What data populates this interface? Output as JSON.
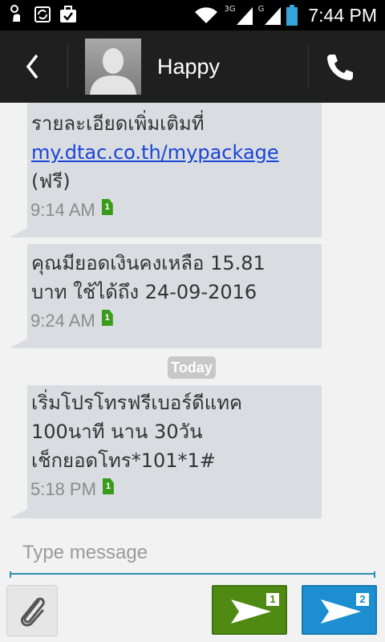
{
  "status_bar": {
    "time": "7:44 PM",
    "network_3g": "3G",
    "network_g": "G",
    "icons": [
      "touch-icon",
      "sync-icon",
      "briefcase-check-icon",
      "wifi-icon",
      "signal-icon",
      "signal-icon",
      "battery-icon"
    ]
  },
  "header": {
    "contact_name": "Happy",
    "back_icon": "chevron-left-icon",
    "call_icon": "phone-icon"
  },
  "messages": [
    {
      "lines": [
        "รายละเอียดเพิ่มเติมที่"
      ],
      "link": "my.dtac.co.th/mypackage",
      "after_link": "(ฟรี)",
      "time": "9:14 AM",
      "sim": "1"
    },
    {
      "text": "คุณมียอดเงินคงเหลือ 15.81\nบาท ใช้ได้ถึง 24-09-2016",
      "time": "9:24 AM",
      "sim": "1"
    },
    {
      "text": "เริ่มโปรโทรฟรีเบอร์ดีแทค\n100นาที นาน 30วัน\nเช็กยอดโทร*101*1#",
      "time": "5:18 PM",
      "sim": "1"
    }
  ],
  "date_divider": "Today",
  "compose": {
    "placeholder": "Type message",
    "value": ""
  },
  "buttons": {
    "attach_icon": "paperclip-icon",
    "send_sim1_badge": "1",
    "send_sim2_badge": "2"
  },
  "colors": {
    "bubble": "#d9dde2",
    "link": "#1a44d6",
    "send_sim1": "#4f8a12",
    "send_sim2": "#1d8fd1",
    "accent_line": "#2f8fb6"
  }
}
